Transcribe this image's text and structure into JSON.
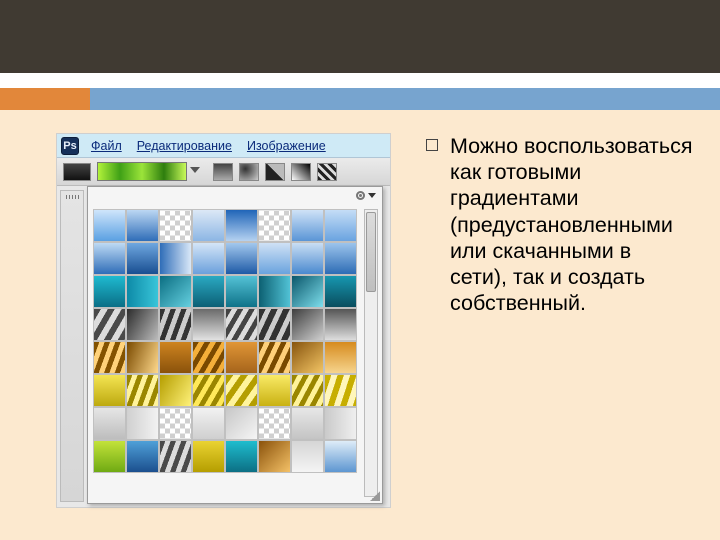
{
  "slide": {
    "body": "Можно воспользоваться как готовыми градиентами (предустановленными или скачанными в сети), так и создать собственный."
  },
  "ps": {
    "icon_label": "Ps",
    "menu": {
      "file": "Файл",
      "edit": "Редактирование",
      "image": "Изображение"
    }
  },
  "swatches": [
    {
      "css": "linear-gradient(#cfe5fb,#5aa0e2)"
    },
    {
      "css": "linear-gradient(#bcd7f3,#2f6db8)"
    },
    {
      "t": true
    },
    {
      "css": "linear-gradient(#dce8f6,#8cb6e4)"
    },
    {
      "css": "linear-gradient(#2065b8,#b5d2f1)"
    },
    {
      "t": true
    },
    {
      "css": "linear-gradient(#cfe2f7,#5a95d6)"
    },
    {
      "css": "linear-gradient(#c4ddf6,#6aa3e0)"
    },
    {
      "css": "linear-gradient(#bedaf4,#2f6db8)"
    },
    {
      "css": "linear-gradient(#6fa7e0,#184e91)"
    },
    {
      "css": "linear-gradient(90deg,#2f6db8,#d9e8f8)"
    },
    {
      "css": "linear-gradient(#d4e5f7,#6ba0dc)"
    },
    {
      "css": "linear-gradient(#a3c8ee,#1e5aa6)"
    },
    {
      "css": "linear-gradient(#cfe1f5,#6aa3de)"
    },
    {
      "css": "linear-gradient(#c9def4,#4a89cf)"
    },
    {
      "css": "linear-gradient(#9cc4ec,#2d6cb5)"
    },
    {
      "css": "linear-gradient(#1fbad0,#0a6e86)"
    },
    {
      "css": "linear-gradient(90deg,#0d8aa7,#39c5d9)"
    },
    {
      "css": "linear-gradient(135deg,#0b6e82,#65d0e0)"
    },
    {
      "css": "linear-gradient(#2aa9c2,#0c5f75)"
    },
    {
      "css": "linear-gradient(#54c2d6,#0e7288)"
    },
    {
      "css": "linear-gradient(90deg,#0c6072,#51c2d5)"
    },
    {
      "css": "linear-gradient(135deg,#0a566a,#7edeec)"
    },
    {
      "css": "linear-gradient(#1797b0,#0a4d5e)"
    },
    {
      "css": "repeating-linear-gradient(120deg,#4a4a4a 0 6px,#dcdcdc 6px 12px)"
    },
    {
      "css": "linear-gradient(120deg,#2c2c2c,#bcbcbc)"
    },
    {
      "css": "repeating-linear-gradient(110deg,#333 0 5px,#ccc 5px 10px)"
    },
    {
      "css": "linear-gradient(#6a6a6a,#e2e2e2)"
    },
    {
      "css": "repeating-linear-gradient(120deg,#444 0 5px,#ddd 5px 10px)"
    },
    {
      "css": "repeating-linear-gradient(115deg,#333 0 6px,#ccc 6px 11px)"
    },
    {
      "css": "linear-gradient(140deg,#3d3d3d,#cfcfcf)"
    },
    {
      "css": "linear-gradient(#555,#ddd)"
    },
    {
      "css": "repeating-linear-gradient(110deg,#845300 0 5px,#ffd27a 5px 10px)"
    },
    {
      "css": "linear-gradient(110deg,#7a4a00,#ffd98c)"
    },
    {
      "css": "linear-gradient(#ce8420,#8a520b)"
    },
    {
      "css": "repeating-linear-gradient(120deg,#7a4900 0 5px,#f4af3a 5px 10px)"
    },
    {
      "css": "linear-gradient(#e19636,#a5641b)"
    },
    {
      "css": "repeating-linear-gradient(115deg,#7a4a00 0 5px,#ffd07a 5px 10px)"
    },
    {
      "css": "linear-gradient(140deg,#87540e,#f3c565)"
    },
    {
      "css": "linear-gradient(#d68b1e,#f6d48d)"
    },
    {
      "css": "linear-gradient(#f4e453,#bda90f)"
    },
    {
      "css": "repeating-linear-gradient(110deg,#9a8600 0 5px,#fff39a 5px 10px)"
    },
    {
      "css": "linear-gradient(120deg,#b59e00,#fff27a)"
    },
    {
      "css": "repeating-linear-gradient(120deg,#9a8600 0 5px,#ffe95a 5px 10px)"
    },
    {
      "css": "repeating-linear-gradient(125deg,#b49e00 0 6px,#fff49c 6px 12px)"
    },
    {
      "css": "linear-gradient(#f9ea66,#c9b112)"
    },
    {
      "css": "repeating-linear-gradient(118deg,#9a8600 0 5px,#fff39a 5px 10px)"
    },
    {
      "css": "repeating-linear-gradient(108deg,#c7ae00 0 6px,#fff6bb 6px 12px)"
    },
    {
      "css": "linear-gradient(#e6e6e6,#bdbdbd)"
    },
    {
      "css": "linear-gradient(90deg,#d0d0d0,#f2f2f2)"
    },
    {
      "t": true
    },
    {
      "css": "linear-gradient(#f2f2f2,#cfcfcf)"
    },
    {
      "css": "linear-gradient(135deg,#c7c7c7,#f5f5f5)"
    },
    {
      "t": true
    },
    {
      "css": "linear-gradient(#e7e7e7,#c4c4c4)"
    },
    {
      "css": "linear-gradient(90deg,#cacaca,#efefef)"
    },
    {
      "css": "linear-gradient(#c3e23a,#6faa13)"
    },
    {
      "css": "linear-gradient(#4fa0d8,#1b4f8e)"
    },
    {
      "css": "repeating-linear-gradient(110deg,#4a4a4a 0 5px,#dcdcdc 5px 10px)"
    },
    {
      "css": "linear-gradient(#ead332,#b59e00)"
    },
    {
      "css": "linear-gradient(#1fbdce,#0c6f84)"
    },
    {
      "css": "linear-gradient(135deg,#8a520b,#f4c167)"
    },
    {
      "css": "linear-gradient(#d5d5d5,#f4f4f4)"
    },
    {
      "css": "linear-gradient(#deecf8,#5d96d1)"
    }
  ]
}
